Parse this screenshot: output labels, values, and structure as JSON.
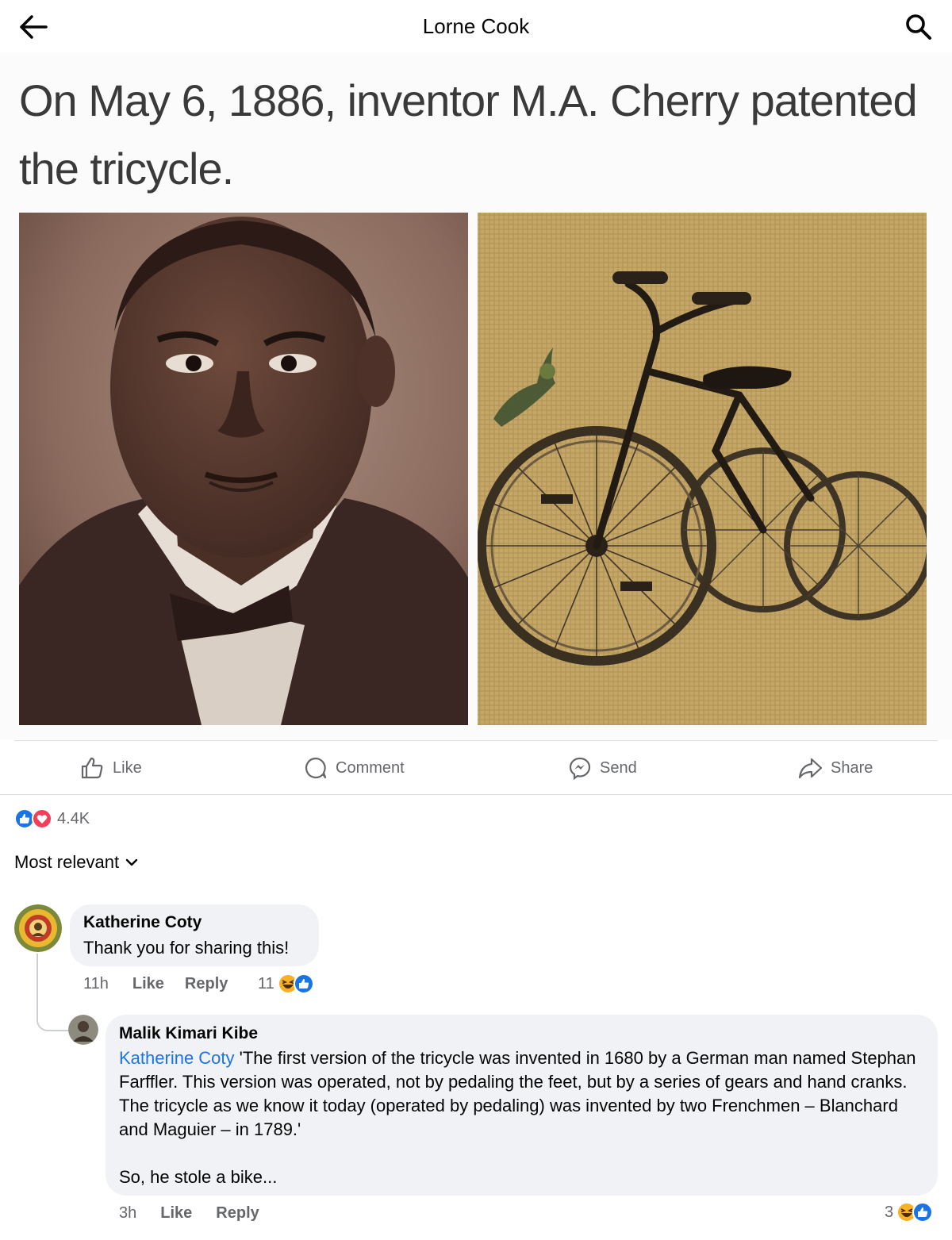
{
  "header": {
    "title": "Lorne Cook",
    "back_icon": "arrow-left-icon",
    "search_icon": "search-icon"
  },
  "post": {
    "headline": "On May 6, 1886, inventor M.A. Cherry patented the tricycle.",
    "images": [
      {
        "name": "portrait-photo",
        "description_icon": "sepia-portrait"
      },
      {
        "name": "tricycle-illustration",
        "description_icon": "tricycle"
      }
    ]
  },
  "actions": {
    "like": "Like",
    "comment": "Comment",
    "send": "Send",
    "share": "Share"
  },
  "reactions": {
    "count": "4.4K",
    "types": [
      "like",
      "love"
    ]
  },
  "comments_sort": {
    "label": "Most relevant"
  },
  "comments": [
    {
      "author": "Katherine Coty",
      "text": "Thank you for sharing this!",
      "time": "11h",
      "like": "Like",
      "reply": "Reply",
      "reaction_count": "11",
      "reaction_types": [
        "haha",
        "like"
      ]
    },
    {
      "author": "Malik Kimari Kibe",
      "mention": "Katherine Coty",
      "text": " 'The first version of the tricycle was invented in 1680 by a German man named Stephan Farffler. This version was operated, not by pedaling the feet, but by a series of gears and hand cranks. The tricycle as we know it today (operated by pedaling) was invented by two Frenchmen – Blanchard and Maguier – in 1789.'",
      "text2": "So, he stole a bike...",
      "time": "3h",
      "like": "Like",
      "reply": "Reply",
      "reaction_count": "3",
      "reaction_types": [
        "haha",
        "like"
      ]
    }
  ],
  "colors": {
    "facebook_blue": "#1b74e4",
    "love_red": "#f33e58",
    "haha_yellow": "#f7b125",
    "secondary_text": "#65676b",
    "bubble_bg": "#f0f2f5"
  }
}
